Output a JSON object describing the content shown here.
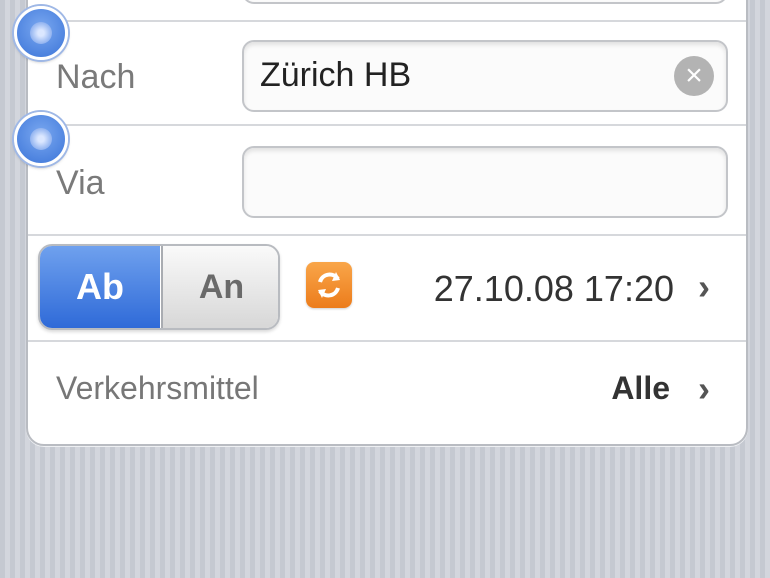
{
  "form": {
    "to": {
      "label": "Nach",
      "value": "Zürich HB"
    },
    "via": {
      "label": "Via",
      "value": ""
    },
    "mode": {
      "departure_label": "Ab",
      "arrival_label": "An",
      "selected": "Ab"
    },
    "datetime": "27.10.08 17:20",
    "transport": {
      "label": "Verkehrsmittel",
      "value": "Alle"
    }
  },
  "icons": {
    "reorder_handle": "reorder-handle-icon",
    "clear": "clear-icon",
    "swap": "swap-icon",
    "chevron": "chevron-right-icon"
  },
  "colors": {
    "accent_blue": "#2f6ad8",
    "swap_orange": "#ec7c1b",
    "background": "#c8ccd4"
  }
}
